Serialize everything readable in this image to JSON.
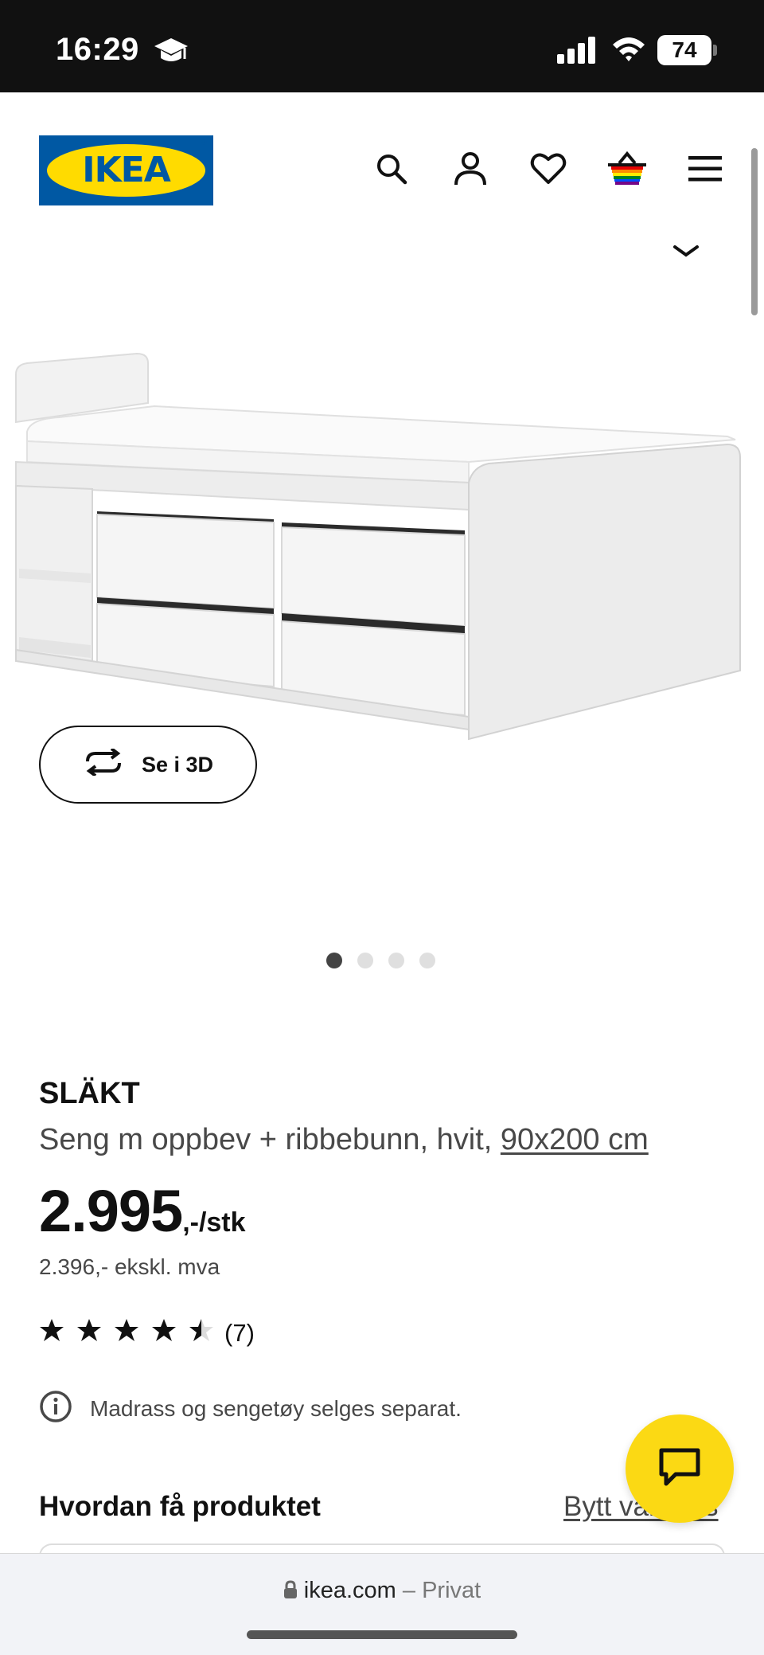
{
  "status_bar": {
    "time": "16:29",
    "battery": "74"
  },
  "header": {
    "logo_text": "IKEA",
    "icons": [
      "search-icon",
      "profile-icon",
      "heart-icon",
      "cart-icon",
      "menu-icon"
    ]
  },
  "gallery": {
    "view_3d_label": "Se i 3D",
    "slide_count": 4,
    "active_slide": 1
  },
  "product": {
    "name": "SLÄKT",
    "description": "Seng m oppbev + ribbebunn, hvit, ",
    "size_link": "90x200 cm",
    "price": "2.995",
    "price_unit": ",-/stk",
    "price_ex_vat": "2.396,- ekskl. mva",
    "rating": 4.5,
    "rating_max": 5,
    "review_count": "(7)",
    "info_note": "Madrass og sengetøy selges separat."
  },
  "delivery": {
    "heading": "Hvordan få produktet",
    "change_link": "Bytt varehus"
  },
  "browser": {
    "domain": "ikea.com",
    "separator": " – ",
    "mode": "Privat"
  },
  "colors": {
    "ikea_blue": "#0058A3",
    "ikea_yellow": "#FFDB00",
    "chat_yellow": "#FBD914"
  }
}
